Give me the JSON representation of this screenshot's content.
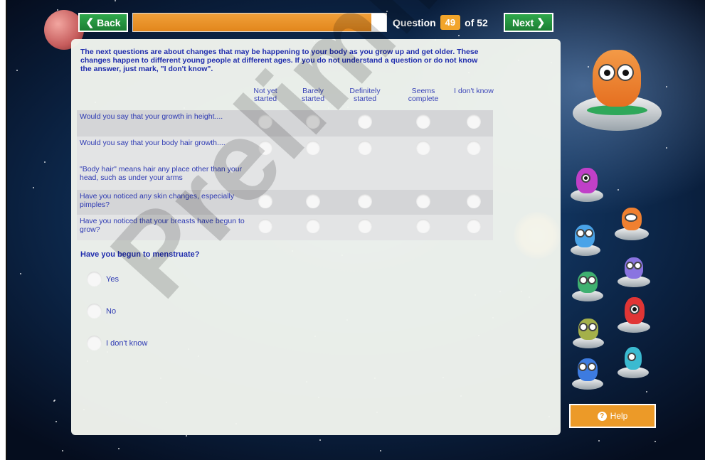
{
  "nav": {
    "back_label": "Back",
    "next_label": "Next",
    "question_label": "Question",
    "question_number": "49",
    "question_total": "of 52",
    "progress": 0.94
  },
  "intro_text": "The next questions are about changes that may be happening to your body as you grow up and get older. These changes happen to different young people at different ages. If you do not understand a question or do not know the answer, just mark, \"I don't know\".",
  "columns": [
    "Not yet started",
    "Barely started",
    "Definitely started",
    "Seems complete",
    "I don't know"
  ],
  "questions": [
    {
      "text": "Would you say that your growth in height....",
      "shade": "shade",
      "has_radios": true
    },
    {
      "text": "Would you say that your body hair growth....",
      "shade": "light",
      "has_radios": true
    },
    {
      "text": "\"Body hair\" means hair any place other than your head, such as under your arms",
      "shade": "light",
      "has_radios": false
    },
    {
      "text": "Have you noticed any skin changes, especially pimples?",
      "shade": "shade",
      "has_radios": true
    },
    {
      "text": "Have you noticed that your breasts have begun to grow?",
      "shade": "light",
      "has_radios": true
    }
  ],
  "menstruate": {
    "question": "Have you begun to menstruate?",
    "options": [
      "Yes",
      "No",
      "I don't know"
    ]
  },
  "help_label": "Help",
  "watermark": "Preliminary",
  "colors": {
    "accent_green": "#2fa84c",
    "accent_orange": "#ec9a28",
    "text_blue": "#1f2cad"
  }
}
